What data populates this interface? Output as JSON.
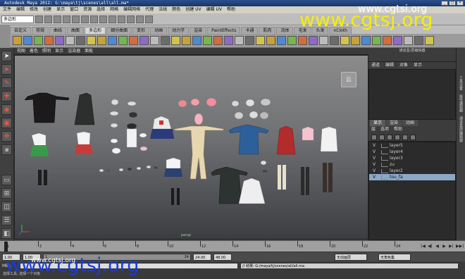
{
  "window": {
    "title": "Autodesk Maya 2012: G:\\maya\\tj\\scenes\\all\\all.ma*",
    "controls": [
      "_",
      "□",
      "×"
    ]
  },
  "menubar": [
    "文件",
    "编辑",
    "修改",
    "创建",
    "显示",
    "窗口",
    "资源",
    "选择",
    "网格",
    "编辑网格",
    "代理",
    "法线",
    "颜色",
    "创建 UV",
    "编辑 UV",
    "帮助"
  ],
  "statusline": {
    "mode_select": "多边形"
  },
  "shelf": {
    "tabs": [
      "自定义",
      "常规",
      "曲线",
      "曲面",
      "多边形",
      "细分曲面",
      "变形",
      "动画",
      "动力学",
      "渲染",
      "PaintEffects",
      "卡通",
      "肌肉",
      "流体",
      "毛发",
      "头发",
      "nCloth"
    ],
    "active_tab": "多边形"
  },
  "viewport": {
    "menu": [
      "视图",
      "着色",
      "照明",
      "显示",
      "渲染器",
      "面板"
    ],
    "camera_label": "persp",
    "viewcube_label": "后"
  },
  "right_panel": {
    "header": "通道盒/层编辑器",
    "menu": [
      "通道",
      "编辑",
      "对象",
      "显示"
    ],
    "tabs": [
      "显示",
      "渲染",
      "动画"
    ],
    "active_tab": "显示",
    "sub_menu": [
      "层",
      "选项",
      "帮助"
    ],
    "layers": [
      {
        "visible": "V",
        "name": "layer5",
        "selected": false
      },
      {
        "visible": "V",
        "name": "layer4",
        "selected": false
      },
      {
        "visible": "V",
        "name": "layer3",
        "selected": false
      },
      {
        "visible": "V",
        "name": "zu",
        "selected": false
      },
      {
        "visible": "V",
        "name": "layer2",
        "selected": false
      },
      {
        "visible": "V",
        "name": "tou_fa",
        "selected": true
      }
    ]
  },
  "side_tabs": [
    "工具设置",
    "属性编辑器",
    "通道盒/层编辑器"
  ],
  "timeline": {
    "ticks": [
      "1",
      "2",
      "4",
      "6",
      "8",
      "10",
      "12",
      "14",
      "16",
      "18",
      "20",
      "22",
      "24"
    ],
    "current_frame": "1.00",
    "playback_icons": [
      "|◀",
      "◀|",
      "◀",
      "▶",
      "▶|",
      "▶▶|"
    ]
  },
  "range": {
    "start": "1.00",
    "playback_start": "1.00",
    "slider_left": "1",
    "slider_right": "24",
    "playback_end": "24.00",
    "end": "48.00",
    "anim_layer": "无动画层",
    "char_set": "无角色集"
  },
  "command": {
    "mel_label": "MEL",
    "result": "// 结果: G:/maya/tj/scenes/all/all.ma"
  },
  "helpline": "选择工具: 选择一个对象",
  "watermarks": {
    "top_small": "www.cgtsi.org",
    "top_big": "www.cgtsj.org",
    "bottom_big": "www.cgtsj.org",
    "bottom_small": "www.cgtsj.org"
  }
}
